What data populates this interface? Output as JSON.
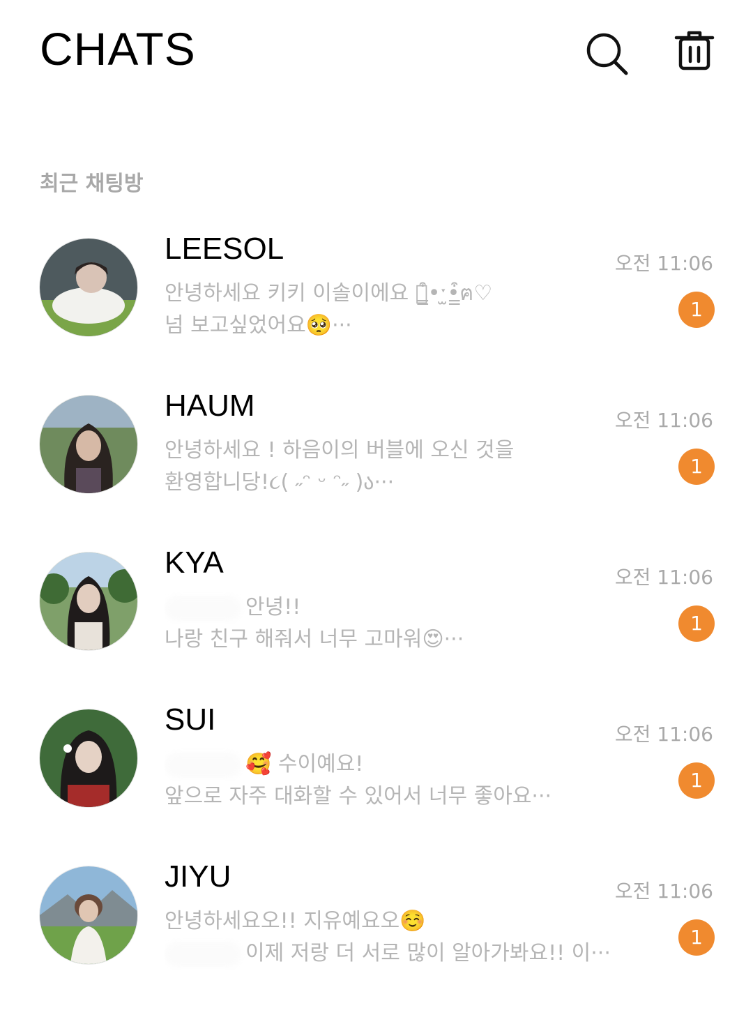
{
  "header": {
    "title": "CHATS",
    "search_icon": "search-icon",
    "trash_icon": "trash-icon"
  },
  "section": {
    "label": "최근 채팅방"
  },
  "chats": [
    {
      "name": "LEESOL",
      "preview_line1": "안녕하세요 키키 이솔이에요 ฅ̳͒•ˑ̫•̳͒ฅ♡",
      "preview_line2": "넘 보고싶었어요🥺···",
      "time": "오전 11:06",
      "unread": "1",
      "avatar_colors": {
        "bg": "#4e5a5e",
        "skin": "#d9c3b6",
        "accent": "#7aa548"
      }
    },
    {
      "name": "HAUM",
      "preview_line1": "안녕하세요 ! 하음이의 버블에 오신 것을",
      "preview_line2": "환영합니당!૮( ˶ᵔ ᵕ ᵔ˶ )ა···",
      "time": "오전 11:06",
      "unread": "1",
      "avatar_colors": {
        "bg": "#6f8b5d",
        "skin": "#d6b9a6",
        "accent": "#2a2320"
      }
    },
    {
      "name": "KYA",
      "preview_line1": "안녕!!",
      "preview_line2": "나랑 친구 해줘서 너무 고마워😍···",
      "time": "오전 11:06",
      "unread": "1",
      "avatar_colors": {
        "bg": "#7fa06a",
        "skin": "#e2cdbf",
        "accent": "#1f1b1b"
      }
    },
    {
      "name": "SUI",
      "preview_line1": "🥰 수이예요!",
      "preview_line2": "앞으로 자주 대화할 수 있어서 너무 좋아요···",
      "time": "오전 11:06",
      "unread": "1",
      "avatar_colors": {
        "bg": "#3f6b3a",
        "skin": "#e5d2c5",
        "accent": "#a52c2a"
      }
    },
    {
      "name": "JIYU",
      "preview_line1": "안녕하세요오!! 지유예요오☺️",
      "preview_line2": "이제 저랑 더 서로 많이 알아가봐요!! 이···",
      "time": "오전 11:06",
      "unread": "1",
      "avatar_colors": {
        "bg": "#8fb7d8",
        "skin": "#e0c6b3",
        "accent": "#6fa24a"
      }
    }
  ]
}
